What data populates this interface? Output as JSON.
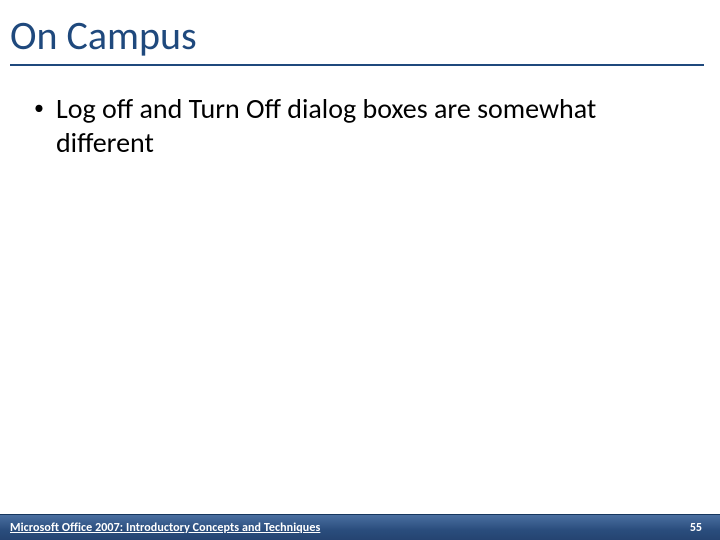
{
  "title": "On Campus",
  "bullets": [
    {
      "text": "Log off and Turn Off dialog boxes are somewhat different"
    }
  ],
  "footer": {
    "left": "Microsoft Office 2007: Introductory Concepts and Techniques",
    "page": "55"
  },
  "colors": {
    "accent": "#1f497d",
    "footer_bg_top": "#4a6fa0",
    "footer_bg_bottom": "#254471"
  }
}
